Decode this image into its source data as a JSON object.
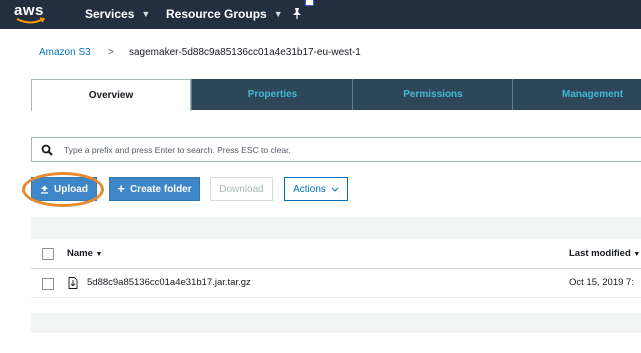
{
  "header": {
    "logo_text": "aws",
    "services_label": "Services",
    "resource_groups_label": "Resource Groups",
    "pin_icon": "pushpin-icon"
  },
  "breadcrumb": {
    "root": "Amazon S3",
    "separator": ">",
    "current": "sagemaker-5d88c9a85136cc01a4e31b17-eu-west-1"
  },
  "tabs": [
    {
      "label": "Overview",
      "active": true
    },
    {
      "label": "Properties",
      "active": false
    },
    {
      "label": "Permissions",
      "active": false
    },
    {
      "label": "Management",
      "active": false
    }
  ],
  "search": {
    "placeholder": "Type a prefix and press Enter to search. Press ESC to clear."
  },
  "toolbar": {
    "upload_label": "Upload",
    "create_folder_label": "Create folder",
    "download_label": "Download",
    "actions_label": "Actions"
  },
  "table": {
    "columns": [
      "Name",
      "Last modified"
    ],
    "rows": [
      {
        "name": "5d88c9a85136cc01a4e31b17.jar.tar.gz",
        "last_modified": "Oct 15, 2019 7:"
      }
    ]
  },
  "colors": {
    "topbar": "#232f3e",
    "primary": "#3f86c8",
    "tab_inactive": "#2e4758",
    "tab_text": "#44b9d6",
    "highlight": "#e88b2e"
  }
}
